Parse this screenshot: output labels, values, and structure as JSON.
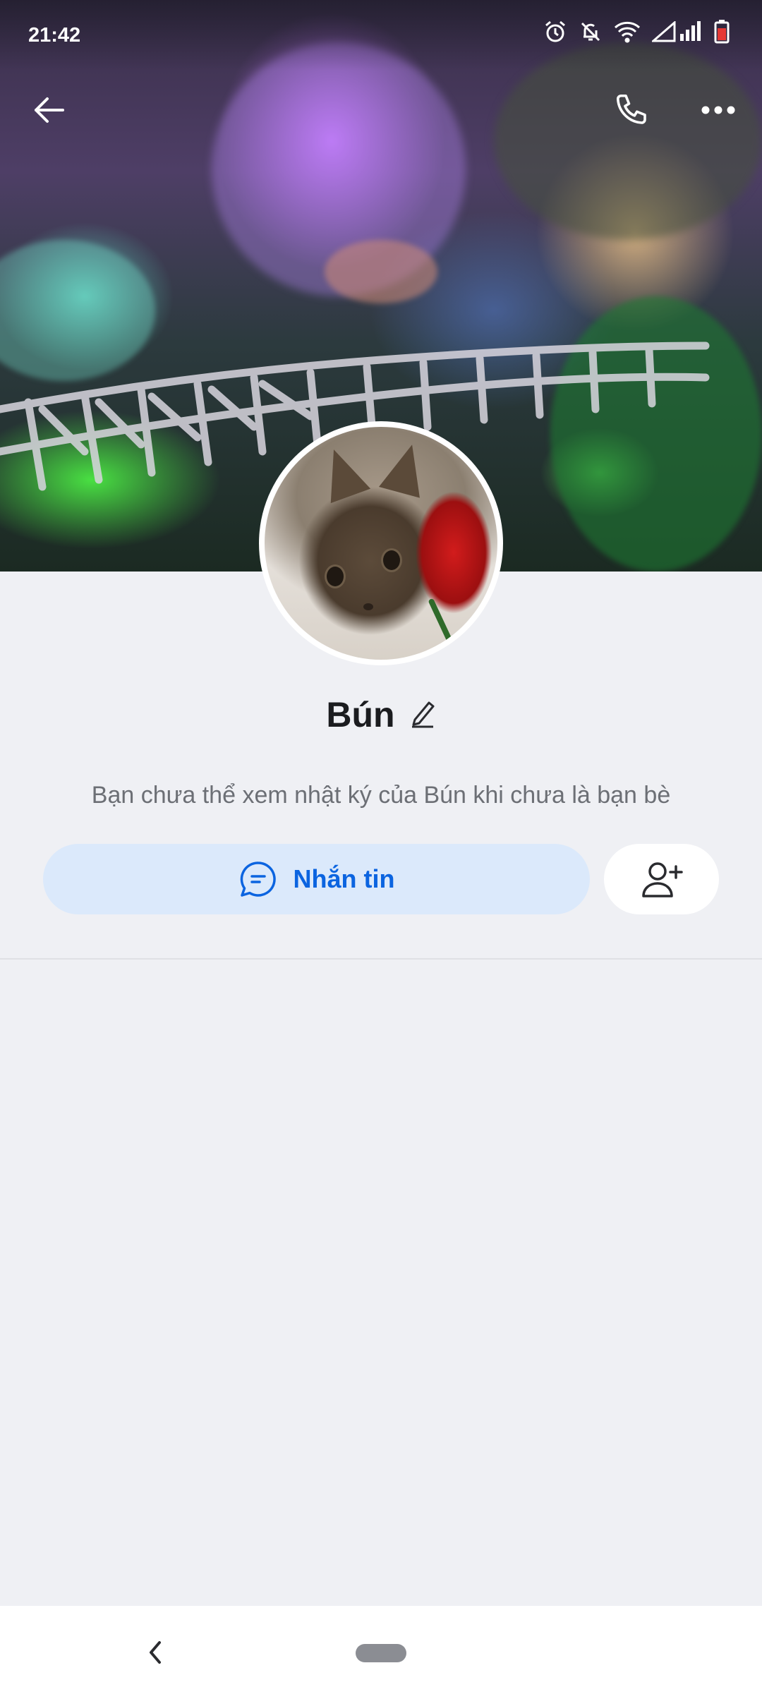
{
  "status_bar": {
    "time": "21:42",
    "icons": [
      "alarm-icon",
      "notifications-off-icon",
      "wifi-icon",
      "signal-icon",
      "battery-low-icon"
    ]
  },
  "header": {
    "back_icon": "arrow-left-icon",
    "call_icon": "phone-icon",
    "more_icon": "more-horizontal-icon"
  },
  "profile": {
    "name": "Bún",
    "edit_icon": "pencil-icon",
    "notice": "Bạn chưa thể xem nhật ký của Bún khi chưa là bạn bè"
  },
  "actions": {
    "message_label": "Nhắn tin",
    "message_icon": "chat-bubble-icon",
    "add_friend_icon": "add-user-icon"
  },
  "colors": {
    "accent": "#0b64e0",
    "message_button_bg": "#dbe9fb",
    "page_bg": "#eff0f4"
  },
  "nav": {
    "back_icon": "chevron-left-icon",
    "home_icon": "home-pill-icon"
  }
}
